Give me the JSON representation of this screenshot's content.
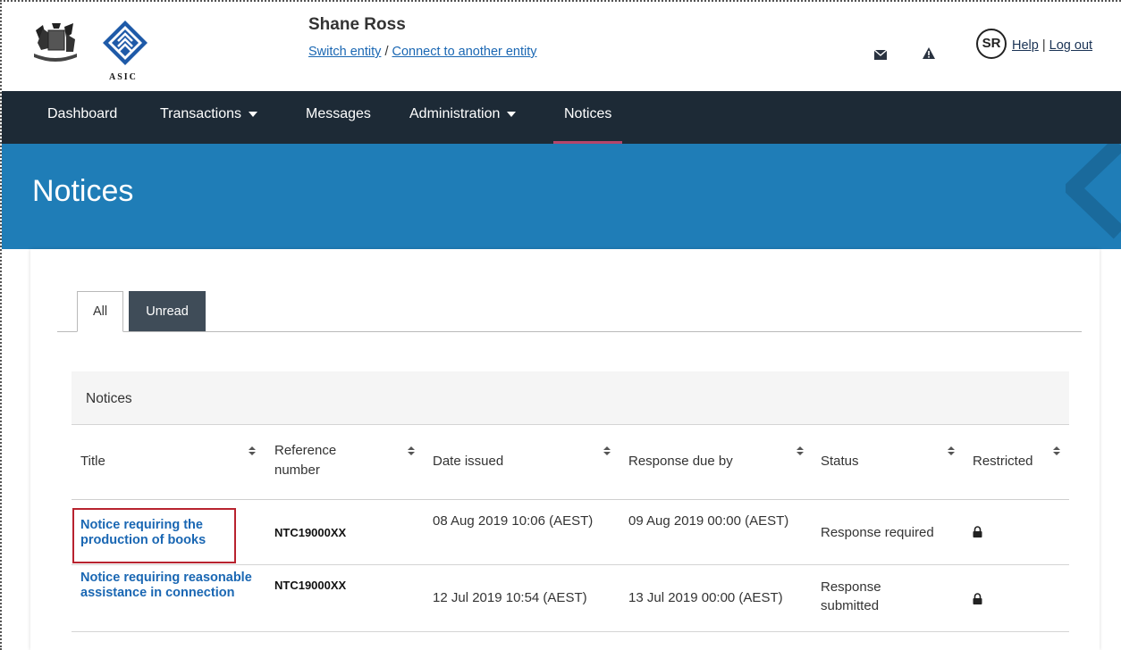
{
  "header": {
    "logo_text": "ASIC",
    "user_name": "Shane Ross",
    "switch_entity": "Switch entity",
    "separator": "/",
    "connect_entity": "Connect to another entity",
    "avatar_initials": "SR",
    "help": "Help",
    "pipe": "|",
    "logout": "Log out"
  },
  "nav": {
    "items": [
      "Dashboard",
      "Transactions",
      "Messages",
      "Administration",
      "Notices"
    ],
    "active": "Notices"
  },
  "banner": {
    "title": "Notices"
  },
  "tabs": {
    "all": "All",
    "unread": "Unread",
    "active": "All"
  },
  "panel": {
    "heading": "Notices"
  },
  "table": {
    "columns": [
      "Title",
      "Reference number",
      "Date issued",
      "Response due by",
      "Status",
      "Restricted"
    ],
    "rows": [
      {
        "title": "Notice requiring the production of books",
        "reference": "NTC19000XX",
        "date_issued": "08 Aug 2019 10:06 (AEST)",
        "response_due": "09 Aug 2019 00:00 (AEST)",
        "status": "Response required",
        "restricted_icon": "lock-icon"
      },
      {
        "title": "Notice requiring reasonable assistance in connection",
        "reference": "NTC19000XX",
        "date_issued": "12 Jul 2019 10:54 (AEST)",
        "response_due": "13 Jul 2019 00:00 (AEST)",
        "status": "Response submitted",
        "restricted_icon": "lock-icon"
      }
    ]
  },
  "colors": {
    "nav_bg": "#1d2a36",
    "banner_bg": "#1f7db7",
    "link": "#1a67b3",
    "active_underline": "#b6456b",
    "highlight": "#b8232f"
  }
}
